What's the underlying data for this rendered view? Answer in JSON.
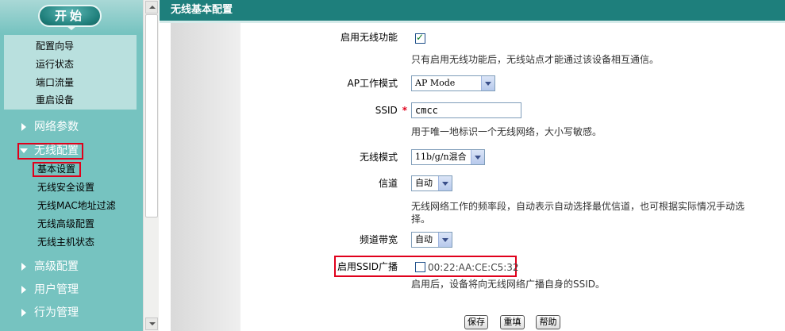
{
  "sidebar": {
    "start_label": "开始",
    "quick_items": [
      "配置向导",
      "运行状态",
      "端口流量",
      "重启设备"
    ],
    "categories": {
      "network": "网络参数",
      "wireless": "无线配置",
      "advanced": "高级配置",
      "users": "用户管理",
      "behavior": "行为管理"
    },
    "wireless_sub": [
      "基本设置",
      "无线安全设置",
      "无线MAC地址过滤",
      "无线高级配置",
      "无线主机状态"
    ]
  },
  "main": {
    "title": "无线基本配置",
    "fields": {
      "enable_wireless": {
        "label": "启用无线功能",
        "checked": true,
        "hint": "只有启用无线功能后，无线站点才能通过该设备相互通信。"
      },
      "ap_mode": {
        "label": "AP工作模式",
        "value": "AP Mode"
      },
      "ssid": {
        "label": "SSID",
        "required_mark": "*",
        "value": "cmcc",
        "hint": "用于唯一地标识一个无线网络，大小写敏感。"
      },
      "wireless_mode": {
        "label": "无线模式",
        "value": "11b/g/n混合"
      },
      "channel": {
        "label": "信道",
        "value": "自动",
        "hint": "无线网络工作的频率段，自动表示自动选择最优信道，也可根据实际情况手动选择。"
      },
      "bandwidth": {
        "label": "频道带宽",
        "value": "自动"
      },
      "ssid_broadcast": {
        "label": "启用SSID广播",
        "checked": false,
        "mac": "00:22:AA:CE:C5:32",
        "hint": "启用后，设备将向无线网络广播自身的SSID。"
      }
    },
    "buttons": {
      "save": "保存",
      "reset": "重填",
      "help": "帮助"
    }
  },
  "colors": {
    "sidebar_bg": "#76c3c0",
    "title_bar": "#1e7f7c",
    "highlight_red": "#e0001b"
  }
}
